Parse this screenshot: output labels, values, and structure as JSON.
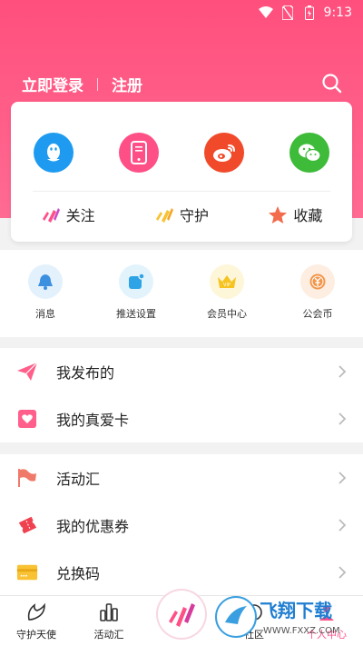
{
  "status_bar": {
    "time": "9:13"
  },
  "header": {
    "login_label": "立即登录",
    "register_label": "注册"
  },
  "card": {
    "socials": [
      {
        "name": "qq-icon",
        "color": "#1e9bf0"
      },
      {
        "name": "phone-icon",
        "color": "#ff4f87"
      },
      {
        "name": "weibo-icon",
        "color": "#f04a2b"
      },
      {
        "name": "wechat-icon",
        "color": "#3dbb39"
      }
    ],
    "actions": [
      {
        "label": "关注"
      },
      {
        "label": "守护"
      },
      {
        "label": "收藏"
      }
    ]
  },
  "quick_links": [
    {
      "label": "消息"
    },
    {
      "label": "推送设置"
    },
    {
      "label": "会员中心"
    },
    {
      "label": "公会币"
    }
  ],
  "menu_group1": [
    {
      "label": "我发布的"
    },
    {
      "label": "我的真爱卡"
    }
  ],
  "menu_group2": [
    {
      "label": "活动汇"
    },
    {
      "label": "我的优惠券"
    },
    {
      "label": "兑换码"
    }
  ],
  "tabbar": {
    "tabs": [
      {
        "label": "守护天使"
      },
      {
        "label": "活动汇"
      },
      {
        "label": ""
      },
      {
        "label": "社区"
      },
      {
        "label": "个人中心"
      }
    ]
  },
  "watermark": {
    "text": "飞翔下载",
    "url": "WWW.FXXZ.COM"
  },
  "colors": {
    "brand": "#ff4f7d",
    "accent_gold": "#f8c234"
  }
}
